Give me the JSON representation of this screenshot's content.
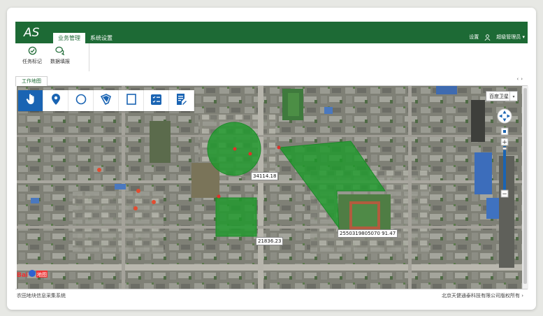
{
  "app": {
    "logo_text": "AS"
  },
  "nav": {
    "tabs": [
      {
        "label": "业务管理",
        "active": true
      },
      {
        "label": "系统设置",
        "active": false
      }
    ],
    "settings_label": "设置",
    "user_label": "超级管理员"
  },
  "ribbon": {
    "tools": [
      {
        "label": "任务标记",
        "icon": "check-circle-icon"
      },
      {
        "label": "数据填报",
        "icon": "chat-bubbles-icon"
      }
    ]
  },
  "workspace": {
    "tab_label": "工作地图"
  },
  "map": {
    "toolbar": [
      {
        "name": "pan-hand-icon",
        "active": true
      },
      {
        "name": "marker-pin-icon",
        "active": false
      },
      {
        "name": "circle-draw-icon",
        "active": false
      },
      {
        "name": "polygon-draw-icon",
        "active": false
      },
      {
        "name": "rectangle-draw-icon",
        "active": false
      },
      {
        "name": "checklist-icon",
        "active": false
      },
      {
        "name": "edit-list-icon",
        "active": false
      }
    ],
    "map_type": "百度卫星",
    "measurements": {
      "circle": "34114.18",
      "rectangle": "21836.23",
      "polygon": "2550319805070 91.47"
    },
    "baidu_logo_text": "Bai",
    "baidu_logo_suffix": "地图"
  },
  "footer": {
    "left": "农田地块信息采集系统",
    "right": "北京天健通泰科技有限公司版权所有"
  },
  "colors": {
    "brand": "#1d6a35",
    "active_tool": "#1a64b3",
    "shape_fill": "#1f9a2c"
  }
}
